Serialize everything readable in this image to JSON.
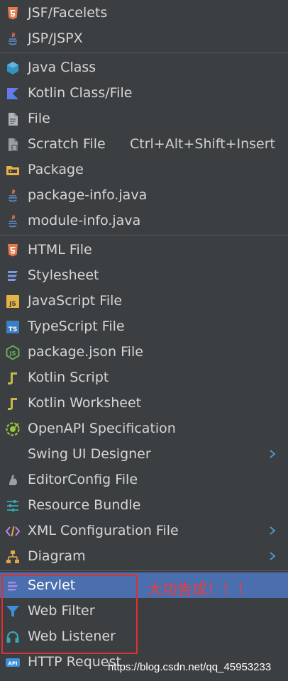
{
  "menu": {
    "groups": [
      {
        "items": [
          {
            "label": "JSF/Facelets",
            "icon": "html5-icon"
          },
          {
            "label": "JSP/JSPX",
            "icon": "java-cup-icon"
          }
        ]
      },
      {
        "items": [
          {
            "label": "Java Class",
            "icon": "java-class-icon"
          },
          {
            "label": "Kotlin Class/File",
            "icon": "kotlin-icon"
          },
          {
            "label": "File",
            "icon": "file-icon"
          },
          {
            "label": "Scratch File",
            "icon": "scratch-file-icon",
            "shortcut": "Ctrl+Alt+Shift+Insert"
          },
          {
            "label": "Package",
            "icon": "package-folder-icon"
          },
          {
            "label": "package-info.java",
            "icon": "java-cup-icon"
          },
          {
            "label": "module-info.java",
            "icon": "java-cup-icon"
          }
        ]
      },
      {
        "items": [
          {
            "label": "HTML File",
            "icon": "html5-icon"
          },
          {
            "label": "Stylesheet",
            "icon": "css-icon"
          },
          {
            "label": "JavaScript File",
            "icon": "javascript-icon"
          },
          {
            "label": "TypeScript File",
            "icon": "typescript-icon"
          },
          {
            "label": "package.json File",
            "icon": "nodejs-icon"
          },
          {
            "label": "Kotlin Script",
            "icon": "kotlin-script-icon"
          },
          {
            "label": "Kotlin Worksheet",
            "icon": "kotlin-worksheet-icon"
          },
          {
            "label": "OpenAPI Specification",
            "icon": "openapi-icon"
          },
          {
            "label": "Swing UI Designer",
            "icon": "",
            "submenu": true
          },
          {
            "label": "EditorConfig File",
            "icon": "editorconfig-icon"
          },
          {
            "label": "Resource Bundle",
            "icon": "resource-bundle-icon"
          },
          {
            "label": "XML Configuration File",
            "icon": "xml-icon",
            "submenu": true
          },
          {
            "label": "Diagram",
            "icon": "diagram-icon",
            "submenu": true
          }
        ]
      },
      {
        "items": [
          {
            "label": "Servlet",
            "icon": "servlet-icon",
            "selected": true
          },
          {
            "label": "Web Filter",
            "icon": "filter-icon"
          },
          {
            "label": "Web Listener",
            "icon": "headphones-icon"
          },
          {
            "label": "HTTP Request",
            "icon": "api-icon"
          }
        ]
      }
    ]
  },
  "annotation": {
    "text": "大功告成！！！",
    "color": "#ef3b3b"
  },
  "watermark": "https://blog.csdn.net/qq_45953233",
  "colors": {
    "background": "#3c3f41",
    "selected": "#4b6eaf",
    "text": "#d6d6d6"
  }
}
